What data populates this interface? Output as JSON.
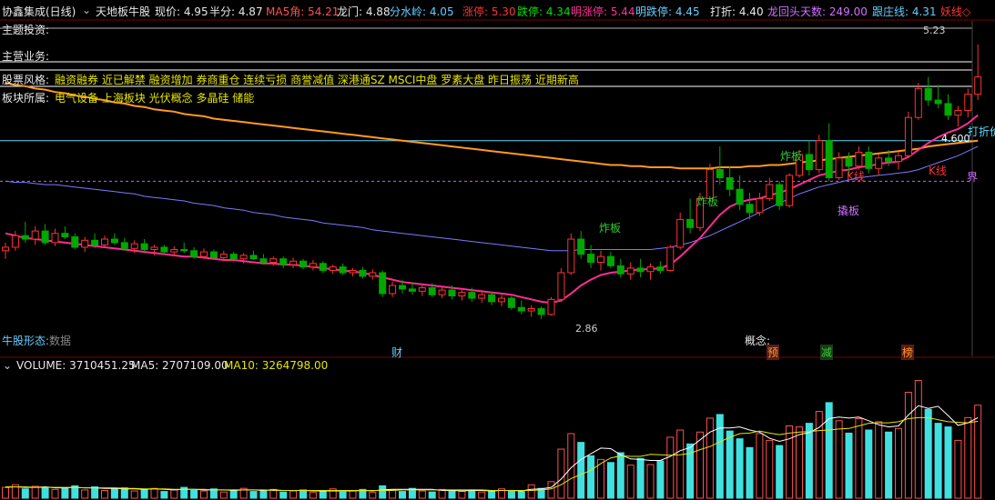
{
  "header": {
    "title": "协鑫集成(日线)",
    "indicator_name": "天地板牛股",
    "price_label": "现价: 4.95",
    "half_label": "半分: 4.87",
    "ma5_angle_label": "MA5角: 54.21",
    "dragon_gate_label": "龙门: 4.88",
    "watershed_label": "分水岭: 4.05",
    "limit_up_label": "涨停: 5.30",
    "limit_down_label": "跌停: 4.34",
    "next_limit_up_label": "明涨停: 5.44",
    "next_limit_down_label": "明跌停: 4.45",
    "discount_label": "打折: 4.40",
    "dragon_days_label": "龙回头天数: 249.00",
    "follow_line_label": "跟庄线: 4.31",
    "demon_line_label": "妖线◇"
  },
  "info": {
    "theme_investment_label": "主题投资:",
    "main_business_label": "主营业务:",
    "style_label": "股票风格:",
    "style_text": "融资融券 近已解禁 融资增加 券商重仓 连续亏损 商誉减值 深港通SZ MSCI中盘 罗素大盘 昨日振荡 近期新高",
    "sector_label": "板块所属:",
    "sector_text": "电气设备 上海板块 光伏概念 多晶硅 储能",
    "form_label": "牛股形态:",
    "form_value": "数据",
    "concept_label": "概念:"
  },
  "annotations": {
    "high_price": "5.23",
    "low_price": "2.86",
    "price_4600": "4.600",
    "discount_line_text": "打折价",
    "boundary_text": "界",
    "blow_board_text": "炸板",
    "sticky_board_text": "撬板",
    "k_line_text": "K线",
    "marker_cai": "财",
    "marker_yu": "预",
    "marker_jian": "减",
    "marker_bang": "榜"
  },
  "volume": {
    "volume_label": "VOLUME: 3710451.25",
    "ma5_label": "MA5: 2707109.00",
    "ma10_label": "MA10: 3264798.00"
  },
  "colors": {
    "up": "#ff3232",
    "down": "#00a800",
    "ma_pink": "#ff2d96",
    "ma_orange": "#ff9a1e",
    "ma_blue": "#7a7aff",
    "vol_up": "#ff5050",
    "vol_down": "#40e0e0",
    "cyan_line": "#5ad8ff"
  },
  "chart_data": {
    "type": "candlestick",
    "ylim": [
      2.75,
      5.3
    ],
    "reference_lines": {
      "discount": 4.4,
      "boundary": 4.05
    },
    "ohlc": [
      [
        3.45,
        3.52,
        3.38,
        3.48
      ],
      [
        3.48,
        3.62,
        3.45,
        3.58
      ],
      [
        3.58,
        3.7,
        3.52,
        3.55
      ],
      [
        3.55,
        3.66,
        3.5,
        3.62
      ],
      [
        3.62,
        3.68,
        3.5,
        3.52
      ],
      [
        3.52,
        3.64,
        3.49,
        3.6
      ],
      [
        3.6,
        3.66,
        3.55,
        3.57
      ],
      [
        3.57,
        3.6,
        3.46,
        3.48
      ],
      [
        3.48,
        3.57,
        3.44,
        3.54
      ],
      [
        3.54,
        3.6,
        3.47,
        3.5
      ],
      [
        3.5,
        3.58,
        3.48,
        3.55
      ],
      [
        3.55,
        3.6,
        3.5,
        3.52
      ],
      [
        3.52,
        3.56,
        3.45,
        3.47
      ],
      [
        3.47,
        3.54,
        3.43,
        3.51
      ],
      [
        3.51,
        3.55,
        3.44,
        3.46
      ],
      [
        3.46,
        3.5,
        3.41,
        3.48
      ],
      [
        3.48,
        3.5,
        3.42,
        3.44
      ],
      [
        3.44,
        3.49,
        3.4,
        3.46
      ],
      [
        3.46,
        3.52,
        3.43,
        3.45
      ],
      [
        3.45,
        3.48,
        3.38,
        3.4
      ],
      [
        3.4,
        3.47,
        3.38,
        3.44
      ],
      [
        3.44,
        3.46,
        3.37,
        3.39
      ],
      [
        3.39,
        3.45,
        3.36,
        3.42
      ],
      [
        3.42,
        3.44,
        3.35,
        3.38
      ],
      [
        3.38,
        3.43,
        3.34,
        3.41
      ],
      [
        3.41,
        3.45,
        3.37,
        3.38
      ],
      [
        3.38,
        3.42,
        3.33,
        3.35
      ],
      [
        3.35,
        3.4,
        3.32,
        3.38
      ],
      [
        3.38,
        3.4,
        3.3,
        3.33
      ],
      [
        3.33,
        3.39,
        3.3,
        3.36
      ],
      [
        3.36,
        3.38,
        3.29,
        3.31
      ],
      [
        3.31,
        3.37,
        3.28,
        3.34
      ],
      [
        3.34,
        3.36,
        3.26,
        3.28
      ],
      [
        3.28,
        3.33,
        3.25,
        3.31
      ],
      [
        3.31,
        3.34,
        3.24,
        3.26
      ],
      [
        3.26,
        3.3,
        3.23,
        3.28
      ],
      [
        3.28,
        3.31,
        3.21,
        3.23
      ],
      [
        3.23,
        3.29,
        3.2,
        3.26
      ],
      [
        3.26,
        3.28,
        3.05,
        3.08
      ],
      [
        3.08,
        3.18,
        3.05,
        3.15
      ],
      [
        3.15,
        3.2,
        3.08,
        3.12
      ],
      [
        3.12,
        3.18,
        3.07,
        3.1
      ],
      [
        3.1,
        3.16,
        3.06,
        3.13
      ],
      [
        3.13,
        3.17,
        3.05,
        3.07
      ],
      [
        3.07,
        3.14,
        3.04,
        3.11
      ],
      [
        3.11,
        3.15,
        3.03,
        3.06
      ],
      [
        3.06,
        3.12,
        3.02,
        3.09
      ],
      [
        3.09,
        3.13,
        3.01,
        3.04
      ],
      [
        3.04,
        3.1,
        3.0,
        3.07
      ],
      [
        3.07,
        3.1,
        2.98,
        3.01
      ],
      [
        3.01,
        3.07,
        2.97,
        3.04
      ],
      [
        3.04,
        3.06,
        2.94,
        2.96
      ],
      [
        2.96,
        3.02,
        2.9,
        2.93
      ],
      [
        2.93,
        2.98,
        2.88,
        2.95
      ],
      [
        2.95,
        2.97,
        2.86,
        2.9
      ],
      [
        2.9,
        3.05,
        2.89,
        3.03
      ],
      [
        3.03,
        3.3,
        3.01,
        3.26
      ],
      [
        3.26,
        3.6,
        3.24,
        3.55
      ],
      [
        3.55,
        3.62,
        3.38,
        3.42
      ],
      [
        3.42,
        3.5,
        3.3,
        3.35
      ],
      [
        3.35,
        3.45,
        3.28,
        3.4
      ],
      [
        3.4,
        3.44,
        3.3,
        3.32
      ],
      [
        3.32,
        3.38,
        3.22,
        3.25
      ],
      [
        3.25,
        3.35,
        3.2,
        3.3
      ],
      [
        3.3,
        3.38,
        3.22,
        3.27
      ],
      [
        3.27,
        3.34,
        3.2,
        3.31
      ],
      [
        3.31,
        3.36,
        3.25,
        3.28
      ],
      [
        3.28,
        3.5,
        3.27,
        3.48
      ],
      [
        3.48,
        3.78,
        3.46,
        3.72
      ],
      [
        3.72,
        3.9,
        3.6,
        3.65
      ],
      [
        3.65,
        3.95,
        3.62,
        3.9
      ],
      [
        3.9,
        4.2,
        3.88,
        4.15
      ],
      [
        4.15,
        4.35,
        4.02,
        4.08
      ],
      [
        4.08,
        4.18,
        3.92,
        3.98
      ],
      [
        3.98,
        4.1,
        3.8,
        3.85
      ],
      [
        3.85,
        3.95,
        3.72,
        3.78
      ],
      [
        3.78,
        3.95,
        3.75,
        3.9
      ],
      [
        3.9,
        4.08,
        3.88,
        4.02
      ],
      [
        4.02,
        4.05,
        3.8,
        3.84
      ],
      [
        3.84,
        4.12,
        3.82,
        4.1
      ],
      [
        4.1,
        4.32,
        4.08,
        4.28
      ],
      [
        4.28,
        4.4,
        4.1,
        4.15
      ],
      [
        4.15,
        4.45,
        4.12,
        4.4
      ],
      [
        4.4,
        4.55,
        4.05,
        4.08
      ],
      [
        4.08,
        4.3,
        4.06,
        4.25
      ],
      [
        4.25,
        4.3,
        4.1,
        4.18
      ],
      [
        4.18,
        4.35,
        4.15,
        4.3
      ],
      [
        4.3,
        4.35,
        4.12,
        4.16
      ],
      [
        4.16,
        4.28,
        4.1,
        4.25
      ],
      [
        4.25,
        4.32,
        4.18,
        4.22
      ],
      [
        4.22,
        4.3,
        4.15,
        4.27
      ],
      [
        4.27,
        4.65,
        4.25,
        4.6
      ],
      [
        4.6,
        4.9,
        4.58,
        4.85
      ],
      [
        4.85,
        4.95,
        4.7,
        4.75
      ],
      [
        4.75,
        4.88,
        4.68,
        4.72
      ],
      [
        4.72,
        4.8,
        4.58,
        4.62
      ],
      [
        4.62,
        4.7,
        4.52,
        4.66
      ],
      [
        4.66,
        4.85,
        4.6,
        4.8
      ],
      [
        4.8,
        5.23,
        4.75,
        4.95
      ]
    ],
    "ma_pink": [
      3.6,
      3.58,
      3.56,
      3.55,
      3.54,
      3.53,
      3.52,
      3.51,
      3.5,
      3.49,
      3.48,
      3.47,
      3.46,
      3.45,
      3.44,
      3.43,
      3.42,
      3.41,
      3.4,
      3.4,
      3.39,
      3.38,
      3.37,
      3.37,
      3.36,
      3.35,
      3.34,
      3.34,
      3.33,
      3.33,
      3.32,
      3.31,
      3.3,
      3.29,
      3.28,
      3.27,
      3.26,
      3.24,
      3.22,
      3.2,
      3.18,
      3.17,
      3.16,
      3.15,
      3.14,
      3.13,
      3.12,
      3.11,
      3.1,
      3.09,
      3.08,
      3.07,
      3.05,
      3.03,
      3.01,
      3.0,
      3.02,
      3.08,
      3.15,
      3.2,
      3.24,
      3.26,
      3.27,
      3.28,
      3.29,
      3.29,
      3.3,
      3.33,
      3.4,
      3.48,
      3.56,
      3.66,
      3.76,
      3.83,
      3.87,
      3.89,
      3.9,
      3.93,
      3.95,
      3.98,
      4.02,
      4.06,
      4.1,
      4.12,
      4.14,
      4.15,
      4.17,
      4.18,
      4.2,
      4.21,
      4.22,
      4.26,
      4.32,
      4.38,
      4.43,
      4.47,
      4.5,
      4.55,
      4.62
    ],
    "ma_blue": [
      4.05,
      4.04,
      4.04,
      4.03,
      4.02,
      4.02,
      4.01,
      4.0,
      3.99,
      3.98,
      3.97,
      3.96,
      3.95,
      3.94,
      3.92,
      3.91,
      3.9,
      3.89,
      3.88,
      3.86,
      3.85,
      3.84,
      3.82,
      3.81,
      3.8,
      3.78,
      3.77,
      3.76,
      3.74,
      3.73,
      3.72,
      3.71,
      3.69,
      3.68,
      3.67,
      3.66,
      3.65,
      3.63,
      3.62,
      3.61,
      3.6,
      3.59,
      3.58,
      3.57,
      3.56,
      3.55,
      3.54,
      3.53,
      3.52,
      3.51,
      3.5,
      3.49,
      3.48,
      3.47,
      3.46,
      3.45,
      3.45,
      3.45,
      3.46,
      3.46,
      3.46,
      3.46,
      3.46,
      3.46,
      3.46,
      3.46,
      3.47,
      3.48,
      3.5,
      3.52,
      3.55,
      3.58,
      3.62,
      3.66,
      3.7,
      3.74,
      3.78,
      3.82,
      3.86,
      3.9,
      3.94,
      3.97,
      4.0,
      4.02,
      4.04,
      4.06,
      4.08,
      4.09,
      4.1,
      4.11,
      4.12,
      4.13,
      4.15,
      4.18,
      4.21,
      4.24,
      4.27,
      4.31,
      4.35
    ],
    "ma_orange": [
      4.9,
      4.88,
      4.87,
      4.85,
      4.84,
      4.82,
      4.81,
      4.79,
      4.78,
      4.76,
      4.75,
      4.73,
      4.72,
      4.7,
      4.69,
      4.67,
      4.66,
      4.65,
      4.63,
      4.62,
      4.61,
      4.59,
      4.58,
      4.57,
      4.56,
      4.55,
      4.54,
      4.53,
      4.52,
      4.51,
      4.5,
      4.49,
      4.48,
      4.47,
      4.46,
      4.45,
      4.44,
      4.43,
      4.42,
      4.41,
      4.4,
      4.39,
      4.38,
      4.37,
      4.36,
      4.35,
      4.34,
      4.33,
      4.32,
      4.31,
      4.3,
      4.29,
      4.28,
      4.27,
      4.26,
      4.25,
      4.24,
      4.23,
      4.22,
      4.21,
      4.2,
      4.19,
      4.19,
      4.18,
      4.18,
      4.17,
      4.17,
      4.17,
      4.16,
      4.16,
      4.16,
      4.16,
      4.17,
      4.17,
      4.17,
      4.18,
      4.18,
      4.19,
      4.19,
      4.2,
      4.21,
      4.22,
      4.23,
      4.24,
      4.25,
      4.26,
      4.27,
      4.28,
      4.29,
      4.3,
      4.31,
      4.32,
      4.33,
      4.35,
      4.36,
      4.37,
      4.38,
      4.39,
      4.4
    ],
    "volume": [
      2.1,
      2.6,
      1.8,
      2.3,
      2.0,
      1.7,
      1.9,
      2.4,
      1.6,
      2.2,
      1.5,
      1.8,
      2.0,
      1.4,
      1.7,
      1.9,
      1.3,
      1.6,
      2.1,
      1.5,
      1.4,
      1.8,
      1.2,
      1.6,
      1.9,
      1.3,
      1.5,
      1.7,
      1.2,
      1.4,
      1.6,
      1.1,
      1.3,
      1.8,
      1.2,
      1.5,
      1.7,
      1.1,
      2.4,
      1.6,
      1.3,
      1.9,
      1.4,
      1.2,
      1.7,
      1.5,
      1.3,
      1.6,
      1.2,
      1.4,
      1.8,
      1.5,
      1.3,
      2.6,
      1.9,
      3.2,
      9.5,
      12.5,
      10.8,
      8.2,
      7.5,
      6.9,
      8.8,
      6.4,
      7.7,
      6.5,
      7.2,
      11.8,
      13.2,
      10.5,
      12.8,
      15.5,
      16.2,
      13.0,
      11.5,
      9.8,
      12.5,
      11.2,
      10.2,
      14.0,
      13.8,
      14.5,
      16.8,
      18.5,
      15.0,
      12.6,
      15.4,
      13.2,
      14.8,
      12.8,
      13.5,
      20.5,
      22.8,
      17.2,
      14.5,
      13.8,
      11.2,
      15.6,
      18.0
    ],
    "vol_ma5": [
      2.1,
      2.2,
      2.1,
      2.1,
      2.2,
      2.0,
      2.0,
      2.1,
      2.0,
      2.0,
      1.9,
      1.9,
      1.8,
      1.8,
      1.7,
      1.8,
      1.7,
      1.6,
      1.7,
      1.7,
      1.6,
      1.6,
      1.6,
      1.5,
      1.6,
      1.6,
      1.5,
      1.6,
      1.5,
      1.5,
      1.5,
      1.4,
      1.4,
      1.4,
      1.4,
      1.4,
      1.5,
      1.4,
      1.6,
      1.7,
      1.7,
      1.7,
      1.7,
      1.7,
      1.5,
      1.5,
      1.4,
      1.5,
      1.5,
      1.4,
      1.5,
      1.5,
      1.4,
      1.7,
      1.8,
      2.1,
      3.7,
      5.9,
      7.5,
      8.6,
      9.7,
      9.6,
      8.4,
      7.6,
      7.5,
      7.3,
      7.3,
      8.1,
      9.2,
      9.8,
      11.3,
      12.8,
      13.6,
      13.6,
      13.8,
      13.2,
      12.8,
      11.6,
      11.0,
      11.5,
      12.3,
      12.7,
      13.7,
      15.4,
      15.7,
      15.5,
      15.7,
      15.0,
      14.2,
      13.8,
      14.0,
      16.1,
      17.9,
      17.4,
      17.8,
      16.0,
      14.1,
      14.6,
      15.6
    ],
    "vol_ma10": [
      2.2,
      2.2,
      2.2,
      2.1,
      2.1,
      2.1,
      2.1,
      2.1,
      2.0,
      2.0,
      2.0,
      2.0,
      1.9,
      1.9,
      1.8,
      1.8,
      1.8,
      1.7,
      1.7,
      1.7,
      1.7,
      1.6,
      1.6,
      1.6,
      1.6,
      1.6,
      1.6,
      1.5,
      1.5,
      1.5,
      1.5,
      1.5,
      1.5,
      1.5,
      1.5,
      1.5,
      1.5,
      1.5,
      1.5,
      1.5,
      1.6,
      1.6,
      1.6,
      1.6,
      1.6,
      1.6,
      1.6,
      1.6,
      1.6,
      1.5,
      1.5,
      1.5,
      1.5,
      1.5,
      1.6,
      1.8,
      2.6,
      3.8,
      4.6,
      5.4,
      6.7,
      7.8,
      8.2,
      8.1,
      8.1,
      8.5,
      8.4,
      8.3,
      8.4,
      8.7,
      9.4,
      10.0,
      10.9,
      11.8,
      12.5,
      12.6,
      13.0,
      12.6,
      12.3,
      12.6,
      12.8,
      12.9,
      13.1,
      13.2,
      13.4,
      13.5,
      14.0,
      14.5,
      14.6,
      14.6,
      14.8,
      15.4,
      15.6,
      15.6,
      15.2,
      14.8,
      14.7,
      14.6,
      14.9
    ]
  }
}
